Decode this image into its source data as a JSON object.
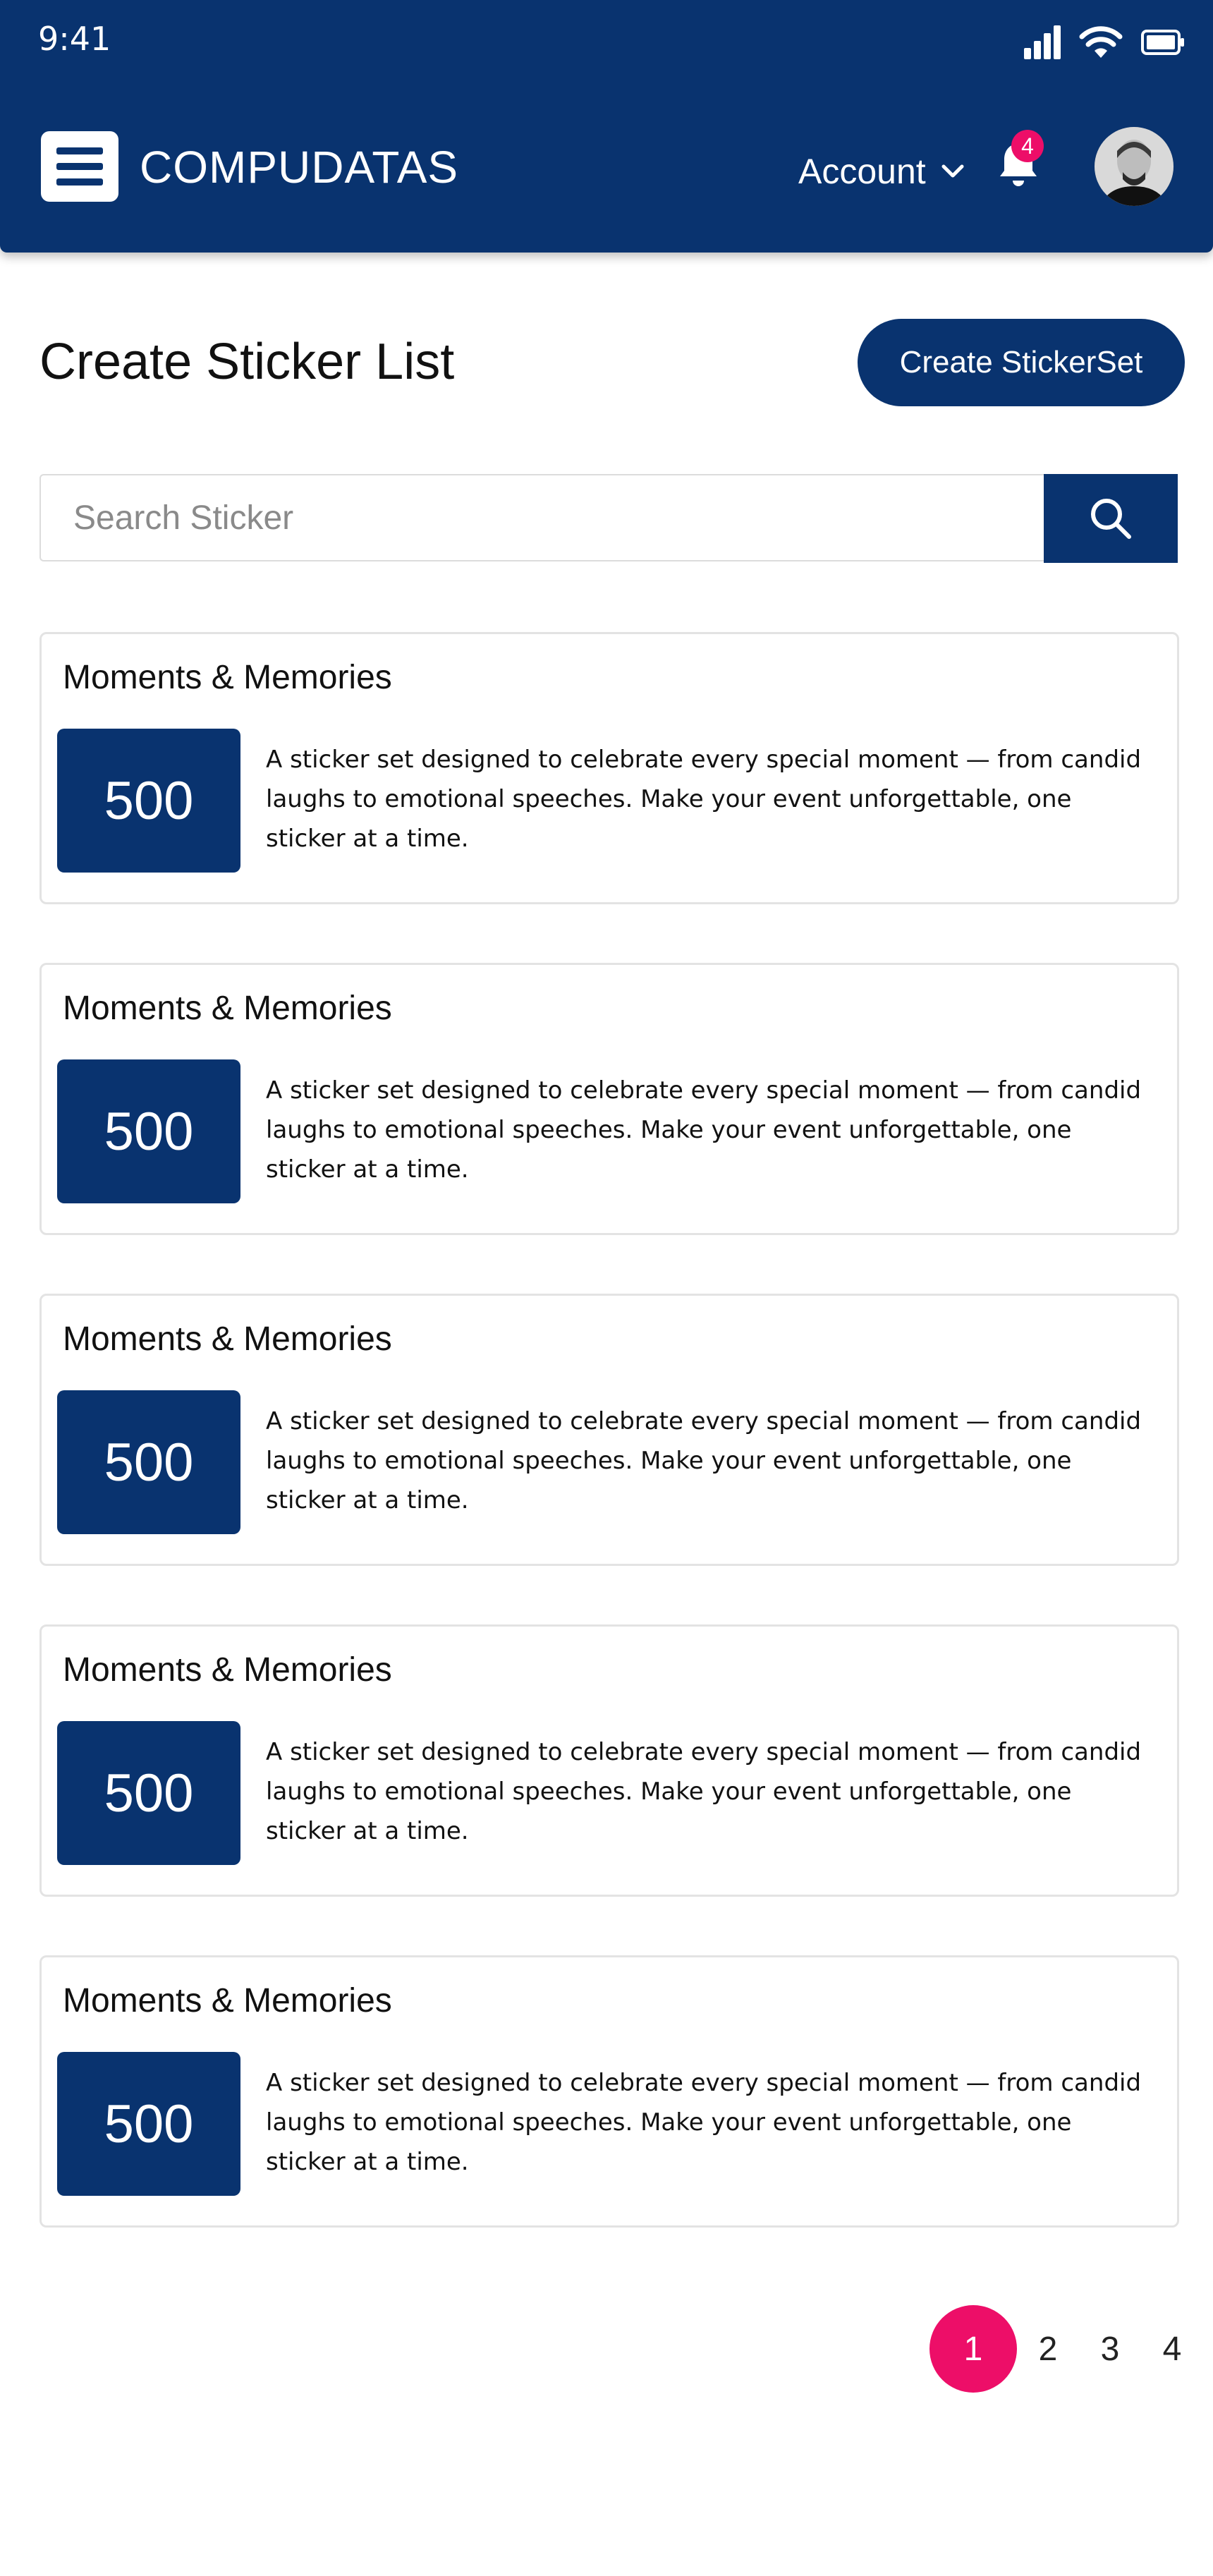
{
  "status_bar": {
    "time": "9:41",
    "icons": [
      "signal-icon",
      "wifi-icon",
      "battery-icon"
    ]
  },
  "app_bar": {
    "brand": "COMPUDATAS",
    "account_label": "Account",
    "notification_count": "4",
    "icons": [
      "menu-icon",
      "chevron-down-icon",
      "bell-icon",
      "avatar"
    ]
  },
  "header": {
    "title": "Create Sticker List",
    "create_button_label": "Create StickerSet"
  },
  "search": {
    "placeholder": "Search Sticker",
    "value": ""
  },
  "cards": [
    {
      "title": "Moments & Memories",
      "count": "500",
      "description": "A sticker set designed to celebrate every special moment — from candid laughs to emotional speeches. Make your event unforgettable, one sticker at a time."
    },
    {
      "title": "Moments & Memories",
      "count": "500",
      "description": "A sticker set designed to celebrate every special moment — from candid laughs to emotional speeches. Make your event unforgettable, one sticker at a time."
    },
    {
      "title": "Moments & Memories",
      "count": "500",
      "description": "A sticker set designed to celebrate every special moment — from candid laughs to emotional speeches. Make your event unforgettable, one sticker at a time."
    },
    {
      "title": "Moments & Memories",
      "count": "500",
      "description": "A sticker set designed to celebrate every special moment — from candid laughs to emotional speeches. Make your event unforgettable, one sticker at a time."
    },
    {
      "title": "Moments & Memories",
      "count": "500",
      "description": "A sticker set designed to celebrate every special moment — from candid laughs to emotional speeches. Make your event unforgettable, one sticker at a time."
    }
  ],
  "pagination": {
    "pages": [
      "1",
      "2",
      "3",
      "4"
    ],
    "current": "1"
  },
  "colors": {
    "primary": "#09336f",
    "accent": "#ed0e68",
    "background": "#ffffff",
    "card_border": "#e3e3e3"
  }
}
